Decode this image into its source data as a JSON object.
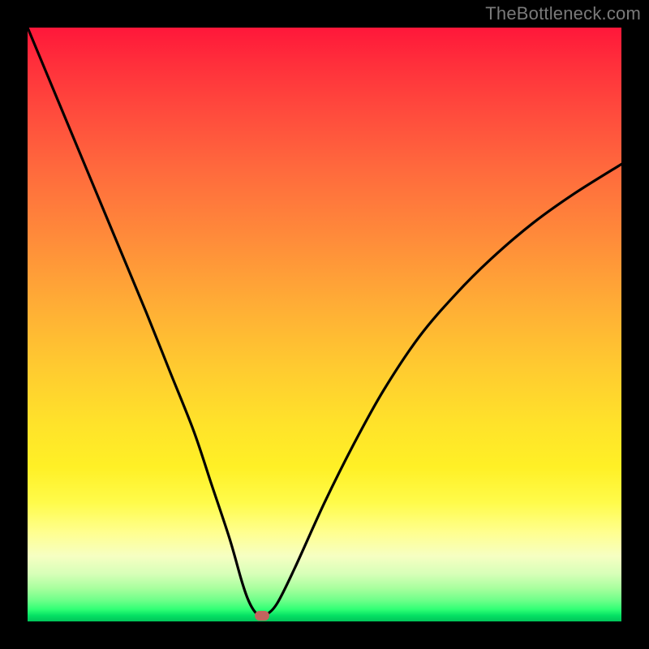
{
  "watermark": "TheBottleneck.com",
  "colors": {
    "bg_frame": "#000000",
    "curve": "#000000",
    "marker": "#c2645e",
    "watermark": "#7a7a7a"
  },
  "chart_data": {
    "type": "line",
    "title": "",
    "xlabel": "",
    "ylabel": "",
    "xlim": [
      0,
      100
    ],
    "ylim": [
      0,
      100
    ],
    "grid": false,
    "legend": false,
    "series": [
      {
        "name": "bottleneck-curve",
        "x": [
          0,
          5,
          10,
          15,
          20,
          24,
          28,
          31,
          34,
          36,
          37,
          38,
          39,
          40,
          42,
          45,
          50,
          55,
          60,
          66,
          72,
          78,
          85,
          92,
          100
        ],
        "values": [
          100,
          88,
          76,
          64,
          52,
          42,
          32,
          23,
          14,
          7,
          4,
          2,
          1,
          1,
          3,
          9,
          20,
          30,
          39,
          48,
          55,
          61,
          67,
          72,
          77
        ]
      }
    ],
    "marker": {
      "x": 39.5,
      "y": 1,
      "shape": "rounded-rect"
    },
    "background_gradient": {
      "direction": "vertical",
      "stops": [
        {
          "pos": 0,
          "color": "#ff173a"
        },
        {
          "pos": 35,
          "color": "#ff8a3a"
        },
        {
          "pos": 67,
          "color": "#ffe32a"
        },
        {
          "pos": 89,
          "color": "#f6ffc2"
        },
        {
          "pos": 100,
          "color": "#00c559"
        }
      ]
    }
  }
}
